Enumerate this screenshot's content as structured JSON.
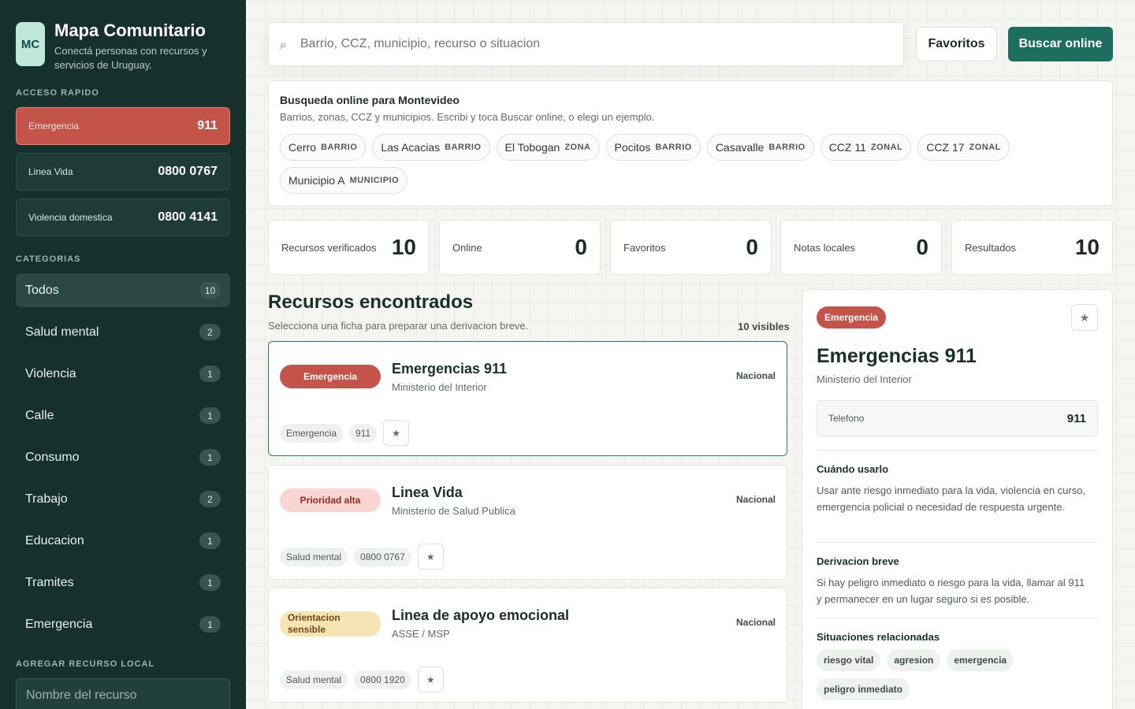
{
  "brand": {
    "logo": "MC",
    "title": "Mapa Comunitario",
    "subtitle": "Conectá personas con recursos y servicios de Uruguay."
  },
  "quick_access": {
    "label": "ACCESO RAPIDO",
    "items": [
      {
        "label": "Emergencia",
        "number": "911"
      },
      {
        "label": "Linea Vida",
        "number": "0800 0767"
      },
      {
        "label": "Violencia domestica",
        "number": "0800 4141"
      }
    ]
  },
  "categories": {
    "label": "CATEGORIAS",
    "items": [
      {
        "label": "Todos",
        "count": "10"
      },
      {
        "label": "Salud mental",
        "count": "2"
      },
      {
        "label": "Violencia",
        "count": "1"
      },
      {
        "label": "Calle",
        "count": "1"
      },
      {
        "label": "Consumo",
        "count": "1"
      },
      {
        "label": "Trabajo",
        "count": "2"
      },
      {
        "label": "Educacion",
        "count": "1"
      },
      {
        "label": "Tramites",
        "count": "1"
      },
      {
        "label": "Emergencia",
        "count": "1"
      }
    ]
  },
  "add_local": {
    "label": "AGREGAR RECURSO LOCAL",
    "placeholder": "Nombre del recurso"
  },
  "search": {
    "icon": "search-icon",
    "placeholder": "Barrio, CCZ, municipio, recurso o situacion",
    "favorites_label": "Favoritos",
    "online_label": "Buscar online"
  },
  "suggestions": {
    "title": "Busqueda online para Montevideo",
    "description": "Barrios, zonas, CCZ y municipios. Escribi y toca Buscar online, o elegi un ejemplo.",
    "chips": [
      {
        "name": "Cerro",
        "kind": "BARRIO"
      },
      {
        "name": "Las Acacias",
        "kind": "BARRIO"
      },
      {
        "name": "El Tobogan",
        "kind": "ZONA"
      },
      {
        "name": "Pocitos",
        "kind": "BARRIO"
      },
      {
        "name": "Casavalle",
        "kind": "BARRIO"
      },
      {
        "name": "CCZ 11",
        "kind": "ZONAL"
      },
      {
        "name": "CCZ 17",
        "kind": "ZONAL"
      },
      {
        "name": "Municipio A",
        "kind": "MUNICIPIO"
      }
    ]
  },
  "stats": [
    {
      "label": "Recursos verificados",
      "value": "10"
    },
    {
      "label": "Online",
      "value": "0"
    },
    {
      "label": "Favoritos",
      "value": "0"
    },
    {
      "label": "Notas locales",
      "value": "0"
    },
    {
      "label": "Resultados",
      "value": "10"
    }
  ],
  "results": {
    "title": "Recursos encontrados",
    "subtitle": "Selecciona una ficha para preparar una derivacion breve.",
    "count": "10 visibles",
    "star": "★",
    "cards": [
      {
        "badge": "Emergencia",
        "title": "Emergencias 911",
        "org": "Ministerio del Interior",
        "scope": "Nacional",
        "tags": [
          "Emergencia",
          "911"
        ]
      },
      {
        "badge": "Prioridad alta",
        "title": "Linea Vida",
        "org": "Ministerio de Salud Publica",
        "scope": "Nacional",
        "tags": [
          "Salud mental",
          "0800 0767"
        ]
      },
      {
        "badge": "Orientacion sensible",
        "title": "Linea de apoyo emocional",
        "org": "ASSE / MSP",
        "scope": "Nacional",
        "tags": [
          "Salud mental",
          "0800 1920"
        ]
      }
    ]
  },
  "detail": {
    "badge": "Emergencia",
    "star": "★",
    "title": "Emergencias 911",
    "org": "Ministerio del Interior",
    "phone_label": "Telefono",
    "phone_value": "911",
    "when_title": "Cuándo usarlo",
    "when_text": "Usar ante riesgo inmediato para la vida, violencia en curso, emergencia policial o necesidad de respuesta urgente.",
    "referral_title": "Derivacion breve",
    "referral_text": "Si hay peligro inmediato o riesgo para la vida, llamar al 911 y permanecer en un lugar seguro si es posible.",
    "related_title": "Situaciones relacionadas",
    "related": [
      "riesgo vital",
      "agresion",
      "emergencia",
      "peligro inmediato"
    ]
  },
  "colors": {
    "sidebar": "#16302c",
    "accent": "#1e6e5f",
    "emergency": "#c4534a",
    "priority_high": "#f9d6d2",
    "sensitive": "#f7e4b5"
  }
}
